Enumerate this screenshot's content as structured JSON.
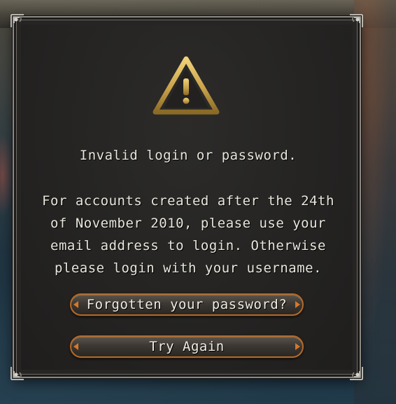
{
  "dialog": {
    "title": "Invalid login or password.",
    "body_lines": [
      "For accounts created after the 24th",
      "of November 2010, please use your",
      "email address to login. Otherwise",
      "please login with your username."
    ],
    "icon": "warning-icon"
  },
  "buttons": {
    "forgot_label": "Forgotten your password?",
    "retry_label": "Try Again"
  },
  "colors": {
    "accent_gold": "#c9a24a",
    "button_border": "#b06a2d",
    "text": "#e8e6dd"
  }
}
